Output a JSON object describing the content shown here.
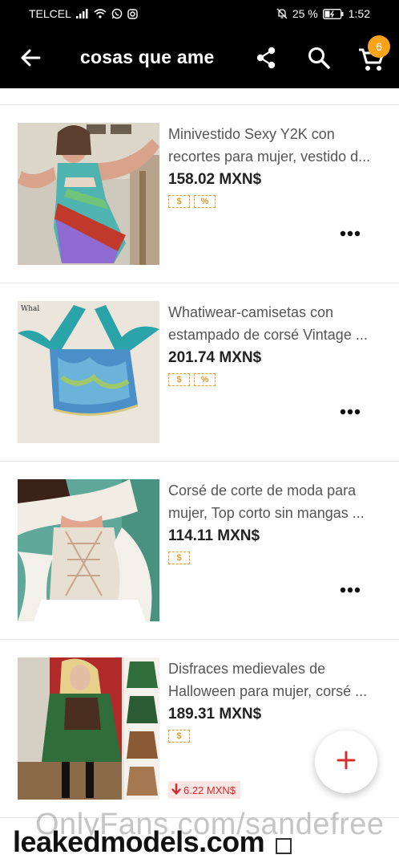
{
  "status_bar": {
    "carrier": "TELCEL",
    "battery": "25 %",
    "time": "1:52",
    "icons": [
      "signal-icon",
      "wifi-icon",
      "whatsapp-icon",
      "instagram-icon",
      "mute-icon",
      "battery-icon"
    ]
  },
  "header": {
    "title": "cosas que ame",
    "cart_count": "6",
    "icons": [
      "back-arrow-icon",
      "share-icon",
      "search-icon",
      "cart-icon"
    ]
  },
  "items": [
    {
      "name_line1": "Minivestido Sexy Y2K con",
      "name_line2": "recortes para mujer, vestido d...",
      "price": "158.02 MXN$",
      "tags": [
        "$",
        "%"
      ],
      "price_drop": ""
    },
    {
      "name_line1": "Whatiwear-camisetas con",
      "name_line2": "estampado de corsé Vintage ...",
      "price": "201.74 MXN$",
      "tags": [
        "$",
        "%"
      ],
      "price_drop": ""
    },
    {
      "name_line1": "Corsé de corte de moda para",
      "name_line2": "mujer, Top corto sin mangas ...",
      "price": "114.11 MXN$",
      "tags": [
        "$"
      ],
      "price_drop": ""
    },
    {
      "name_line1": "Disfraces medievales de",
      "name_line2": "Halloween para mujer, corsé ...",
      "price": "189.31 MXN$",
      "tags": [
        "$"
      ],
      "price_drop": "6.22 MXN$"
    }
  ],
  "watermark": {
    "line1": "OnlyFans.com/sandefree",
    "line2": "leakedmodels.com"
  },
  "colors": {
    "accent": "#f7a21b",
    "tag": "#e39b2e",
    "drop": "#d62a2a",
    "fab_plus": "#d32f2f"
  }
}
